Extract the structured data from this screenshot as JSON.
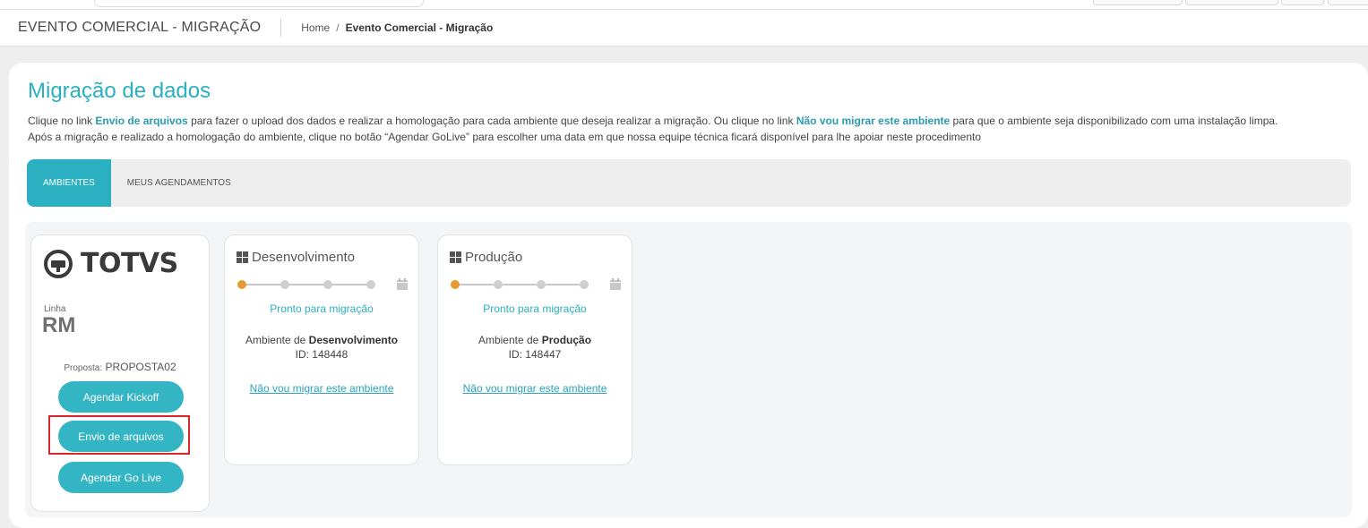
{
  "header": {
    "page_heading": "EVENTO COMERCIAL - MIGRAÇÃO",
    "breadcrumb": {
      "home": "Home",
      "separator": "/",
      "current": "Evento Comercial - Migração"
    }
  },
  "main": {
    "title": "Migração de dados",
    "description": {
      "p1_a": "Clique no link ",
      "p1_link1": "Envio de arquivos",
      "p1_b": " para fazer o upload dos dados e realizar a homologação para cada ambiente que deseja realizar a migração. Ou clique no link ",
      "p1_link2": "Não vou migrar este ambiente",
      "p1_c": " para que o ambiente seja disponibilizado com uma instalação limpa.",
      "p2": "Após a migração e realizado a homologação do ambiente, clique no botão “Agendar GoLive” para escolher uma data em que nossa equipe técnica ficará disponível para lhe apoiar neste procedimento"
    },
    "tabs": [
      {
        "label": "AMBIENTES",
        "active": true
      },
      {
        "label": "MEUS AGENDAMENTOS",
        "active": false
      }
    ]
  },
  "info_card": {
    "logo_text": "TOTVS",
    "linha_label": "Linha",
    "linha_value": "RM",
    "proposta_label": "Proposta:",
    "proposta_value": "PROPOSTA02",
    "buttons": {
      "kickoff": "Agendar Kickoff",
      "upload": "Envio de arquivos",
      "golive": "Agendar Go Live"
    }
  },
  "environments": [
    {
      "name": "Desenvolvimento",
      "status": "Pronto para migração",
      "desc_prefix": "Ambiente de ",
      "desc_name": "Desenvolvimento",
      "id_text": "ID: 148448",
      "skip_link": "Não vou migrar este ambiente",
      "steps_total": 4,
      "step_current": 1
    },
    {
      "name": "Produção",
      "status": "Pronto para migração",
      "desc_prefix": "Ambiente de ",
      "desc_name": "Produção",
      "id_text": "ID: 148447",
      "skip_link": "Não vou migrar este ambiente",
      "steps_total": 4,
      "step_current": 1
    }
  ],
  "icons": {
    "env_icon": "windows-icon",
    "calendar": "calendar-icon",
    "logo": "totvs-logo-icon"
  },
  "colors": {
    "accent": "#2ab0c0",
    "button": "#33b5c4",
    "step_active": "#e89a30",
    "step_inactive": "#cfcfcf",
    "highlight": "#d9262c"
  }
}
